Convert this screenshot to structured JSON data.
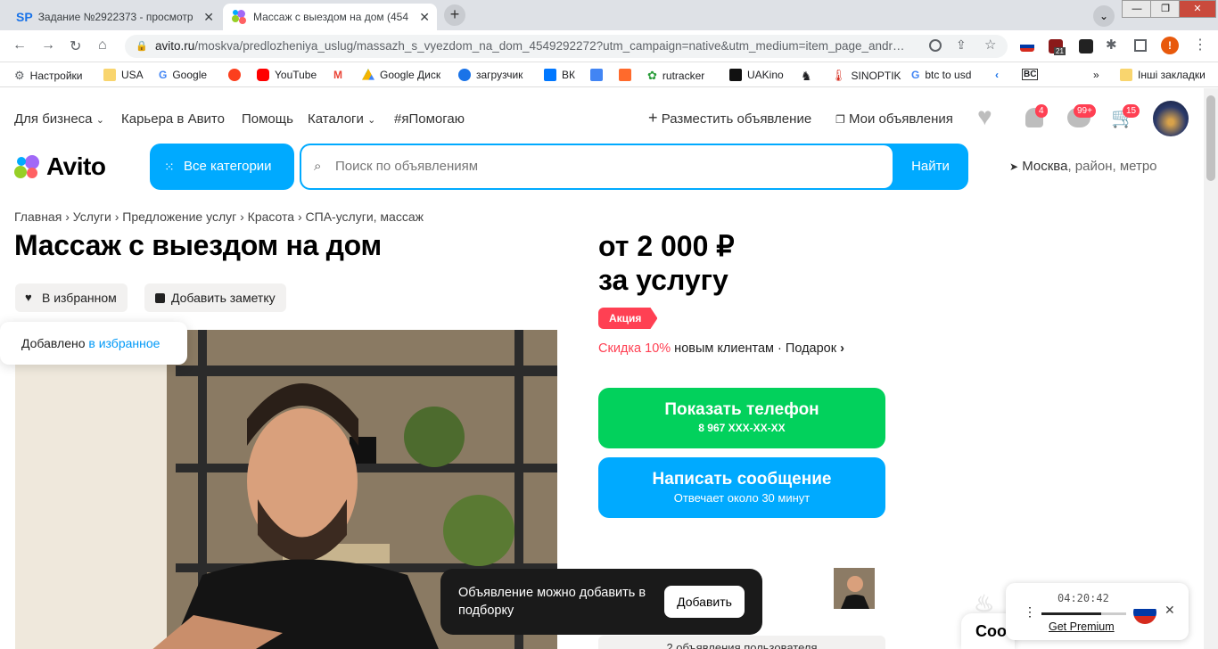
{
  "browser": {
    "tabs": [
      {
        "label": "Задание №2922373 - просмотр",
        "favicon": "SP"
      },
      {
        "label": "Массаж с выездом на дом (454"
      }
    ],
    "url_host": "avito.ru",
    "url_path": "/moskva/predlozheniya_uslug/massazh_s_vyezdom_na_dom_4549292272?utm_campaign=native&utm_medium=item_page_andr…",
    "ext_badge": "21",
    "ext_alert": "!",
    "bookmarks": [
      "Настройки",
      "USA",
      "Google",
      "",
      "YouTube",
      "",
      "Google Диск",
      "загрузчик",
      "ВК",
      "",
      "",
      "rutracker",
      "UAKino",
      "",
      "SINOPTIK",
      "btc to usd",
      "",
      "BC"
    ],
    "other_bookmarks": "Інші закладки"
  },
  "site": {
    "topnav": [
      "Для бизнеса",
      "Карьера в Авито",
      "Помощь",
      "Каталоги",
      "#яПомогаю"
    ],
    "post_ad": "Разместить объявление",
    "my_ads": "Мои объявления",
    "badges": {
      "notifications": "4",
      "messages": "99+",
      "cart": "15"
    },
    "logo": "Avito",
    "all_categories": "Все категории",
    "search_placeholder": "Поиск по объявлениям",
    "search_button": "Найти",
    "location_city": "Москва",
    "location_rest": ", район, метро"
  },
  "listing": {
    "breadcrumbs": [
      "Главная",
      "Услуги",
      "Предложение услуг",
      "Красота",
      "СПА-услуги, массаж"
    ],
    "title": "Массаж с выездом на дом",
    "fav_chip": "В избранном",
    "note_chip": "Добавить заметку",
    "toast_prefix": "Добавлено ",
    "toast_link": "в избранное",
    "price_line1": "от 2 000 ₽",
    "price_line2": "за услугу",
    "promo": "Акция",
    "discount_red": "Скидка 10%",
    "discount_rest": " новым клиентам · Подарок",
    "show_phone": "Показать телефон",
    "phone_masked": "8 967 XXX-XX-XX",
    "write_message": "Написать сообщение",
    "reply_time": "Отвечает около 30 минут",
    "seller_ads": "2 объявления пользователя"
  },
  "popup": {
    "message": "Объявление можно добавить в подборку",
    "button": "Добавить"
  },
  "widget": {
    "timer": "04:20:42",
    "premium": "Get Premium",
    "progress": 0.7
  },
  "chat_tab": "Соо"
}
